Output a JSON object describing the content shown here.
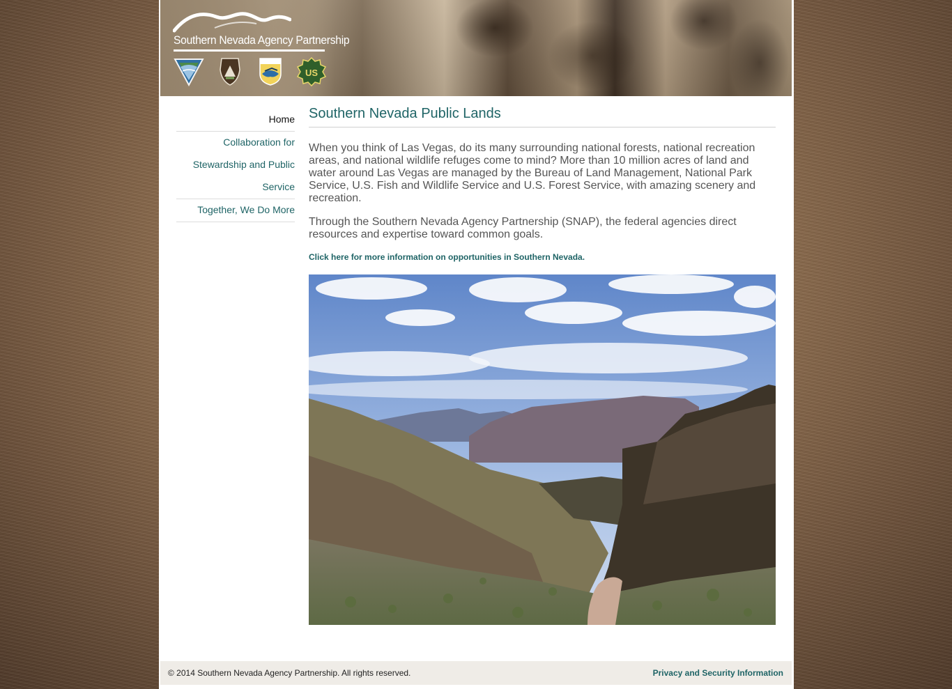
{
  "brand": {
    "logo_text": "Southern Nevada Agency Partnership",
    "badges": [
      "blm-badge-icon",
      "nps-badge-icon",
      "fws-badge-icon",
      "usfs-badge-icon"
    ],
    "usfs_letters": "US"
  },
  "nav": {
    "items": [
      {
        "label": "Home",
        "active": true
      },
      {
        "label": "Collaboration for"
      },
      {
        "label": "Stewardship and Public"
      },
      {
        "label": "Service"
      },
      {
        "label": "Together, We Do More"
      }
    ]
  },
  "main": {
    "title": "Southern Nevada Public Lands",
    "paragraph1": "When you think of Las Vegas, do its many surrounding national forests, national recreation areas, and national wildlife refuges come to mind? More than 10 million acres of land and water around Las Vegas are managed by the Bureau of Land Management, National Park Service, U.S. Fish and Wildlife Service and U.S. Forest Service, with amazing scenery and recreation.",
    "paragraph2": "Through the Southern Nevada Agency Partnership (SNAP), the federal agencies direct resources and expertise toward common goals.",
    "more_link": "Click here for more information on opportunities in Southern Nevada."
  },
  "footer": {
    "copyright": "© 2014 Southern Nevada Agency Partnership. All rights reserved.",
    "privacy_link": "Privacy and Security Information"
  },
  "colors": {
    "link": "#1f6466",
    "text": "#555555",
    "footer_bg": "#efece7"
  }
}
